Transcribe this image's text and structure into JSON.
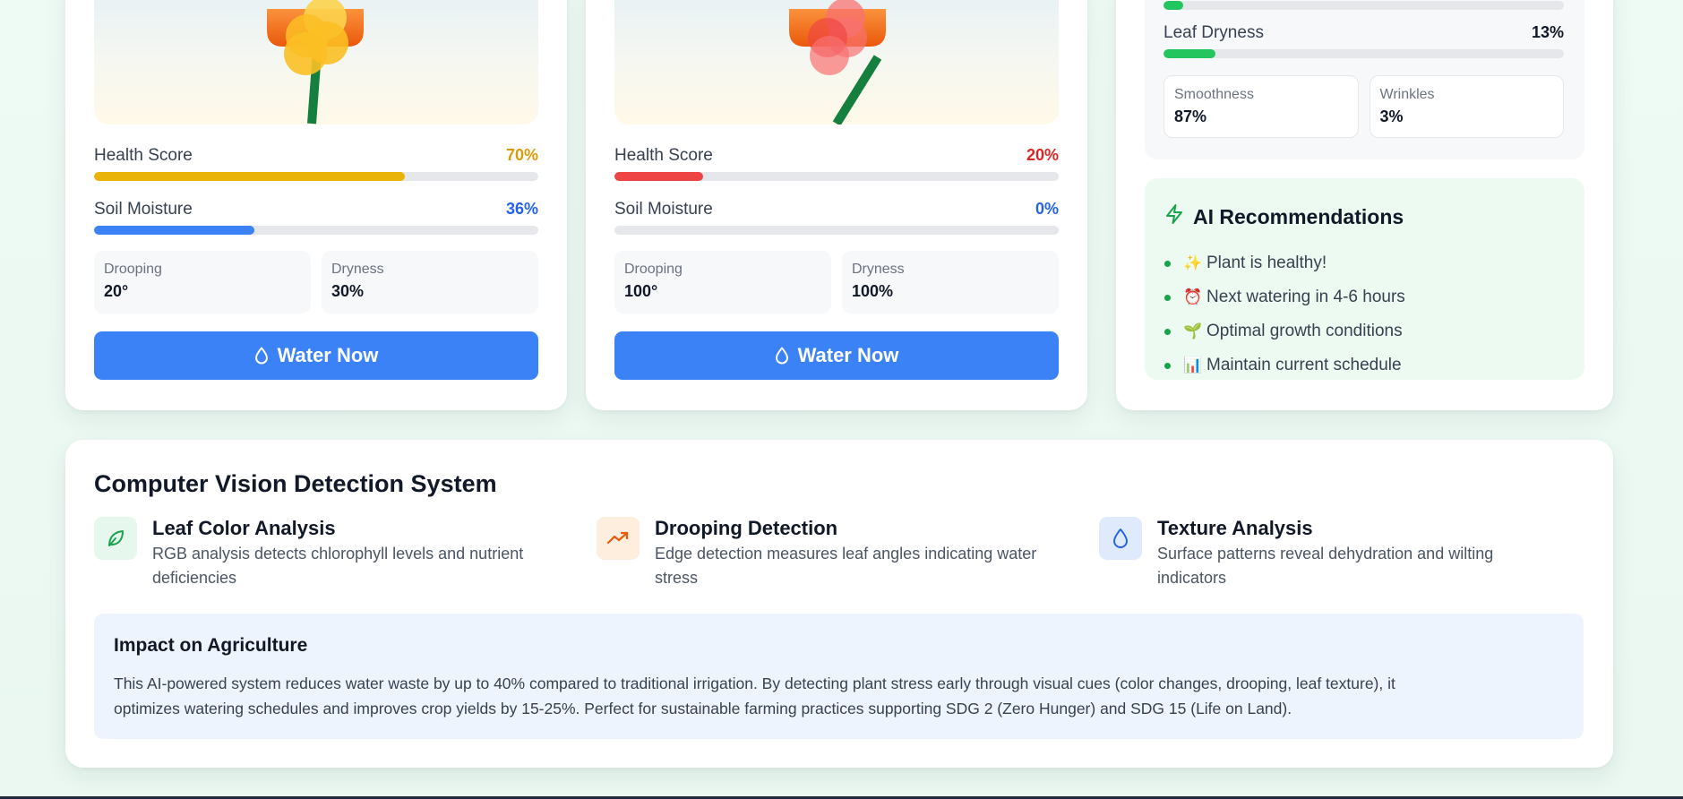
{
  "colors": {
    "health_warning": "#eab308",
    "health_critical": "#ef4444",
    "moisture": "#3b82f6",
    "leaf_dryness": "#22c55e",
    "button": "#3b82f6",
    "ai_panel": "#ecfaf1",
    "impact_panel": "#eef4fd"
  },
  "plants": [
    {
      "health_label": "Health Score",
      "health_value": "70%",
      "health_fraction": 0.7,
      "health_color": "#d89c0b",
      "moisture_label": "Soil Moisture",
      "moisture_value": "36%",
      "moisture_fraction": 0.36,
      "drooping_label": "Drooping",
      "drooping_value": "20°",
      "dryness_label": "Dryness",
      "dryness_value": "30%",
      "button_label": "Water Now",
      "button_icon": "droplet-icon"
    },
    {
      "health_label": "Health Score",
      "health_value": "20%",
      "health_fraction": 0.2,
      "health_color": "#dc2626",
      "moisture_label": "Soil Moisture",
      "moisture_value": "0%",
      "moisture_fraction": 0.0,
      "drooping_label": "Drooping",
      "drooping_value": "100°",
      "dryness_label": "Dryness",
      "dryness_value": "100%",
      "button_label": "Water Now",
      "button_icon": "droplet-icon"
    }
  ],
  "side": {
    "top_bar_fraction": 0.05,
    "leaf_dryness_label": "Leaf Dryness",
    "leaf_dryness_value": "13%",
    "leaf_dryness_fraction": 0.13,
    "smoothness_label": "Smoothness",
    "smoothness_value": "87%",
    "wrinkles_label": "Wrinkles",
    "wrinkles_value": "3%"
  },
  "ai": {
    "title": "AI Recommendations",
    "icon": "lightning-icon",
    "items": [
      {
        "emoji": "✨",
        "text": "Plant is healthy!"
      },
      {
        "emoji": "⏰",
        "text": "Next watering in 4-6 hours"
      },
      {
        "emoji": "🌱",
        "text": "Optimal growth conditions"
      },
      {
        "emoji": "📊",
        "text": "Maintain current schedule"
      }
    ]
  },
  "cv": {
    "title": "Computer Vision Detection System",
    "features": [
      {
        "icon": "leaf-icon",
        "title": "Leaf Color Analysis",
        "desc_line1": "RGB analysis detects chlorophyll levels and nutrient",
        "desc_line2": "deficiencies"
      },
      {
        "icon": "trending-up-icon",
        "title": "Drooping Detection",
        "desc_line1": "Edge detection measures leaf angles indicating water",
        "desc_line2": "stress"
      },
      {
        "icon": "droplet-icon",
        "title": "Texture Analysis",
        "desc_line1": "Surface patterns reveal dehydration and wilting",
        "desc_line2": "indicators"
      }
    ],
    "impact_title": "Impact on Agriculture",
    "impact_line1": "This AI-powered system reduces water waste by up to 40% compared to traditional irrigation. By detecting plant stress early through visual cues (color changes, drooping, leaf texture), it",
    "impact_line2": "optimizes watering schedules and improves crop yields by 15-25%. Perfect for sustainable farming practices supporting SDG 2 (Zero Hunger) and SDG 15 (Life on Land)."
  }
}
